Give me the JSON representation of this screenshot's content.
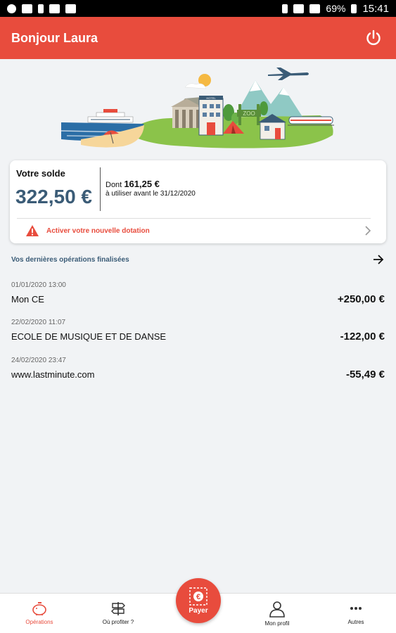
{
  "status_bar": {
    "battery": "69%",
    "time": "15:41"
  },
  "header": {
    "title": "Bonjour Laura"
  },
  "balance_card": {
    "label": "Votre solde",
    "amount": "322,50 €",
    "dont_prefix": "Dont",
    "dont_amount": "161,25 €",
    "until": "à utiliser avant le 31/12/2020",
    "activate_label": "Activer votre nouvelle dotation"
  },
  "operations": {
    "title": "Vos dernières opérations finalisées",
    "items": [
      {
        "date": "01/01/2020 13:00",
        "name": "Mon CE",
        "amount": "+250,00 €"
      },
      {
        "date": "22/02/2020 11:07",
        "name": "ECOLE DE MUSIQUE ET DE DANSE",
        "amount": "-122,00 €"
      },
      {
        "date": "24/02/2020 23:47",
        "name": "www.lastminute.com",
        "amount": "-55,49 €"
      }
    ]
  },
  "illustration": {
    "sign_zoo": "ZOO",
    "sign_hotel": "HOTEL"
  },
  "bottom_nav": {
    "operations": "Opérations",
    "where": "Où profiter ?",
    "pay": "Payer",
    "profile": "Mon profil",
    "others": "Autres"
  },
  "colors": {
    "brand": "#e84c3d",
    "accent_text": "#3b5c77"
  }
}
